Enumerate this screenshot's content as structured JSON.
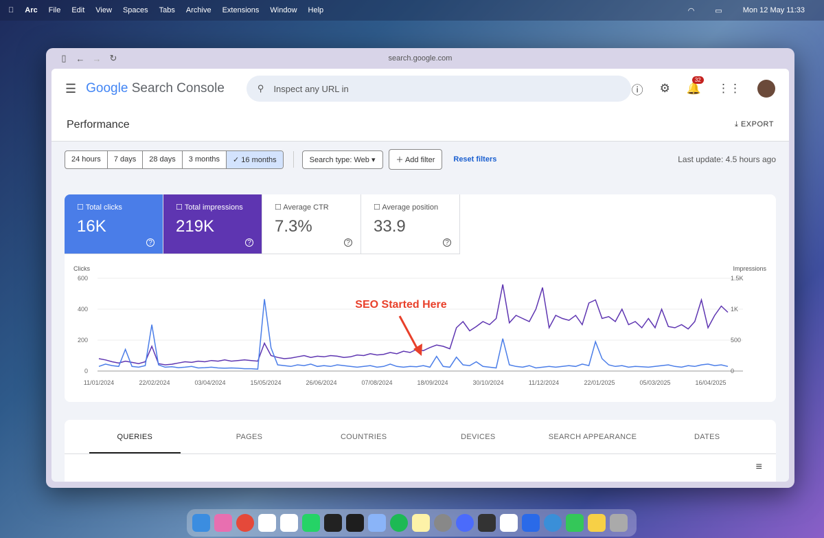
{
  "menubar": {
    "items": [
      "Arc",
      "File",
      "Edit",
      "View",
      "Spaces",
      "Tabs",
      "Archive",
      "Extensions",
      "Window",
      "Help"
    ],
    "clock": "Mon 12 May  11:33"
  },
  "browser": {
    "url": "search.google.com"
  },
  "header": {
    "logo_google": "Google",
    "logo_product": "Search Console",
    "search_placeholder": "Inspect any URL in",
    "notifications": "32"
  },
  "page": {
    "title": "Performance",
    "export": "EXPORT"
  },
  "filters": {
    "ranges": [
      "24 hours",
      "7 days",
      "28 days",
      "3 months",
      "16 months"
    ],
    "selected": "16 months",
    "search_type": "Search type: Web",
    "add_filter": "Add filter",
    "reset": "Reset filters",
    "last_update": "Last update: 4.5 hours ago"
  },
  "metrics": [
    {
      "label": "Total clicks",
      "value": "16K"
    },
    {
      "label": "Total impressions",
      "value": "219K"
    },
    {
      "label": "Average CTR",
      "value": "7.3%"
    },
    {
      "label": "Average position",
      "value": "33.9"
    }
  ],
  "colors": {
    "clicks": "#4a7de8",
    "impressions": "#5e35b1",
    "annotation": "#e8402a"
  },
  "chart_data": {
    "type": "line",
    "ylabel_left": "Clicks",
    "ylabel_right": "Impressions",
    "ylim_left": [
      0,
      600
    ],
    "ylim_right": [
      0,
      1500
    ],
    "yticks_left": [
      "0",
      "200",
      "400",
      "600"
    ],
    "yticks_right": [
      "0",
      "500",
      "1K",
      "1.5K"
    ],
    "xticks": [
      "11/01/2024",
      "22/02/2024",
      "03/04/2024",
      "15/05/2024",
      "26/06/2024",
      "07/08/2024",
      "18/09/2024",
      "30/10/2024",
      "11/12/2024",
      "22/01/2025",
      "05/03/2025",
      "16/04/2025"
    ],
    "x_step_days": 5,
    "annotation": "SEO Started Here",
    "series": [
      {
        "name": "Clicks",
        "axis": "left",
        "values": [
          30,
          45,
          35,
          30,
          140,
          30,
          25,
          35,
          300,
          40,
          25,
          28,
          22,
          25,
          30,
          20,
          22,
          25,
          20,
          18,
          20,
          18,
          15,
          15,
          12,
          465,
          150,
          40,
          35,
          30,
          40,
          35,
          45,
          30,
          35,
          30,
          40,
          35,
          30,
          25,
          30,
          35,
          25,
          30,
          45,
          30,
          25,
          30,
          28,
          35,
          25,
          95,
          30,
          25,
          90,
          40,
          35,
          60,
          30,
          25,
          20,
          210,
          40,
          30,
          25,
          35,
          20,
          25,
          30,
          25,
          30,
          35,
          30,
          45,
          35,
          190,
          80,
          40,
          30,
          35,
          25,
          30,
          28,
          25,
          30,
          35,
          40,
          30,
          25,
          35,
          30,
          40,
          45,
          35,
          40,
          30
        ]
      },
      {
        "name": "Impressions",
        "axis": "right",
        "values": [
          200,
          180,
          150,
          130,
          160,
          140,
          120,
          150,
          400,
          120,
          100,
          110,
          130,
          150,
          140,
          160,
          150,
          170,
          160,
          180,
          160,
          170,
          180,
          170,
          160,
          450,
          250,
          220,
          200,
          210,
          230,
          250,
          220,
          240,
          230,
          250,
          240,
          220,
          230,
          260,
          250,
          280,
          260,
          270,
          300,
          280,
          320,
          300,
          350,
          330,
          380,
          420,
          400,
          360,
          700,
          800,
          650,
          720,
          800,
          750,
          850,
          1400,
          780,
          900,
          850,
          800,
          1000,
          1350,
          700,
          900,
          850,
          820,
          900,
          750,
          1100,
          1150,
          850,
          880,
          800,
          1000,
          750,
          800,
          700,
          850,
          700,
          1000,
          720,
          700,
          750,
          680,
          800,
          1150,
          700,
          900,
          1050,
          950
        ]
      }
    ]
  },
  "tabs": [
    "QUERIES",
    "PAGES",
    "COUNTRIES",
    "DEVICES",
    "SEARCH APPEARANCE",
    "DATES"
  ]
}
